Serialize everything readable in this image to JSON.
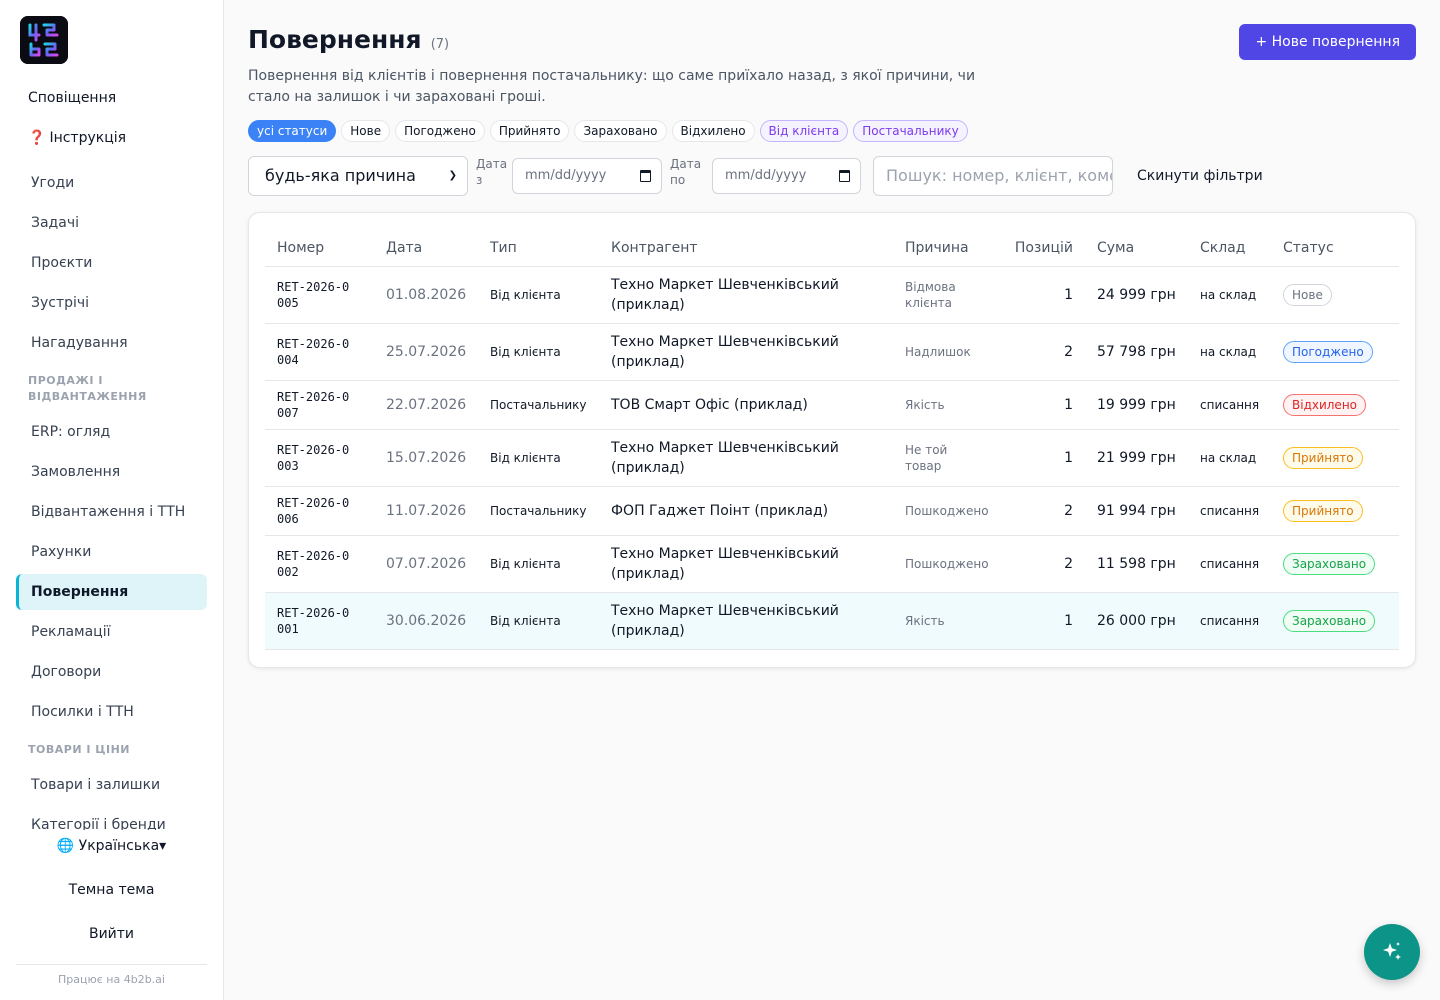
{
  "sidebar": {
    "notifications": "Сповіщення",
    "help_mark": "❓",
    "help": "Інструкція",
    "items_a": [
      "Угоди",
      "Задачі",
      "Проєкти",
      "Зустрічі",
      "Нагадування"
    ],
    "section_sales": "ПРОДАЖІ І ВІДВАНТАЖЕННЯ",
    "items_b": [
      "ERP: огляд",
      "Замовлення",
      "Відвантаження і ТТН",
      "Рахунки",
      "Повернення",
      "Рекламації",
      "Договори",
      "Посилки і ТТН"
    ],
    "active_item": "Повернення",
    "section_goods": "ТОВАРИ І ЦІНИ",
    "items_c": [
      "Товари і залишки",
      "Категорії і бренди"
    ],
    "language": "🌐 Українська▾",
    "dark_theme": "Темна тема",
    "logout": "Вийти",
    "powered": "Працює на 4b2b.ai"
  },
  "header": {
    "title": "Повернення",
    "count": "(7)",
    "new_button": "+ Нове повернення",
    "subtitle": "Повернення від клієнтів і повернення постачальнику: що саме приїхало назад, з якої причини, чи стало на залишок і чи зараховані гроші."
  },
  "chips": [
    {
      "label": "усі статуси",
      "style": "active"
    },
    {
      "label": "Нове",
      "style": "default"
    },
    {
      "label": "Погоджено",
      "style": "default"
    },
    {
      "label": "Прийнято",
      "style": "default"
    },
    {
      "label": "Зараховано",
      "style": "default"
    },
    {
      "label": "Відхилено",
      "style": "default"
    },
    {
      "label": "Від клієнта",
      "style": "purple"
    },
    {
      "label": "Постачальнику",
      "style": "purple"
    }
  ],
  "filters": {
    "reason_value": "будь-яка причина",
    "date_from_label": "Дата з",
    "date_to_label": "Дата по",
    "date_placeholder": "mm/dd/yyyy",
    "search_placeholder": "Пошук: номер, клієнт, коментар",
    "reset": "Скинути фільтри"
  },
  "table": {
    "headers": [
      "Номер",
      "Дата",
      "Тип",
      "Контрагент",
      "Причина",
      "Позицій",
      "Сума",
      "Склад",
      "Статус"
    ],
    "rows": [
      {
        "code": "RET-2026-0005",
        "date": "01.08.2026",
        "type": "Від клієнта",
        "party": "Техно Маркет Шевченківський (приклад)",
        "reason": "Відмова клієнта",
        "qty": "1",
        "sum": "24 999 грн",
        "warehouse": "на склад",
        "status": "Нове",
        "status_color": "#6b7280",
        "status_border": "#d1d5db",
        "status_bg": "#ffffff"
      },
      {
        "code": "RET-2026-0004",
        "date": "25.07.2026",
        "type": "Від клієнта",
        "party": "Техно Маркет Шевченківський (приклад)",
        "reason": "Надлишок",
        "qty": "2",
        "sum": "57 798 грн",
        "warehouse": "на склад",
        "status": "Погоджено",
        "status_color": "#2563eb",
        "status_border": "#60a5fa",
        "status_bg": "#eff6ff"
      },
      {
        "code": "RET-2026-0007",
        "date": "22.07.2026",
        "type": "Постачальнику",
        "party": "ТОВ Смарт Офіс (приклад)",
        "reason": "Якість",
        "qty": "1",
        "sum": "19 999 грн",
        "warehouse": "списання",
        "status": "Відхилено",
        "status_color": "#dc2626",
        "status_border": "#f87171",
        "status_bg": "#fef2f2"
      },
      {
        "code": "RET-2026-0003",
        "date": "15.07.2026",
        "type": "Від клієнта",
        "party": "Техно Маркет Шевченківський (приклад)",
        "reason": "Не той товар",
        "qty": "1",
        "sum": "21 999 грн",
        "warehouse": "на склад",
        "status": "Прийнято",
        "status_color": "#d97706",
        "status_border": "#fbbf24",
        "status_bg": "#fffbeb"
      },
      {
        "code": "RET-2026-0006",
        "date": "11.07.2026",
        "type": "Постачальнику",
        "party": "ФОП Гаджет Поінт (приклад)",
        "reason": "Пошкоджено",
        "qty": "2",
        "sum": "91 994 грн",
        "warehouse": "списання",
        "status": "Прийнято",
        "status_color": "#d97706",
        "status_border": "#fbbf24",
        "status_bg": "#fffbeb"
      },
      {
        "code": "RET-2026-0002",
        "date": "07.07.2026",
        "type": "Від клієнта",
        "party": "Техно Маркет Шевченківський (приклад)",
        "reason": "Пошкоджено",
        "qty": "2",
        "sum": "11 598 грн",
        "warehouse": "списання",
        "status": "Зараховано",
        "status_color": "#16a34a",
        "status_border": "#4ade80",
        "status_bg": "#f0fdf4"
      },
      {
        "code": "RET-2026-0001",
        "date": "30.06.2026",
        "type": "Від клієнта",
        "party": "Техно Маркет Шевченківський (приклад)",
        "reason": "Якість",
        "qty": "1",
        "sum": "26 000 грн",
        "warehouse": "списання",
        "status": "Зараховано",
        "status_color": "#16a34a",
        "status_border": "#4ade80",
        "status_bg": "#f0fdf4"
      }
    ]
  },
  "icons": {
    "logo": "logo-icon",
    "fab": "sparkles-icon"
  }
}
